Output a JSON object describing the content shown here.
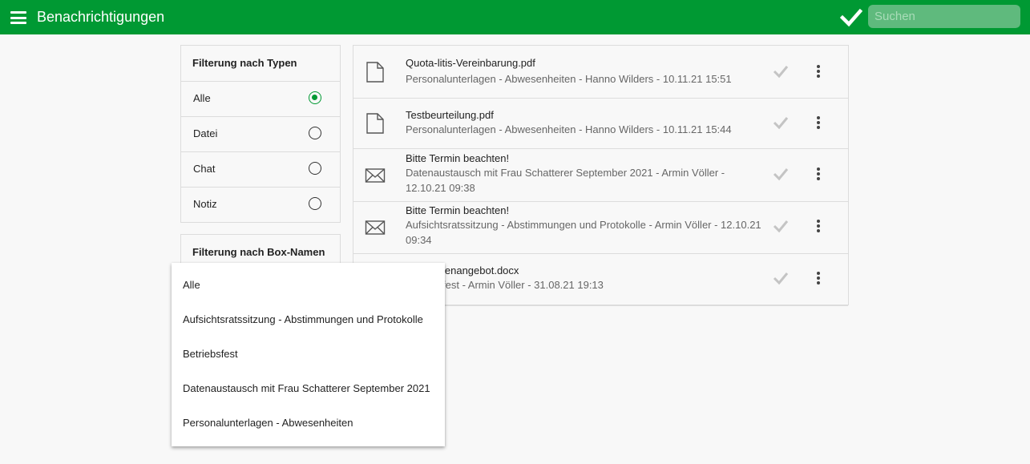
{
  "header": {
    "title": "Benachrichtigungen",
    "menu_icon": "hamburger-menu-icon",
    "check_icon": "checkmark-icon",
    "search_placeholder": "Suchen",
    "search_value": "",
    "colors": {
      "bar": "#009933",
      "search_bg": "#5fba7d"
    }
  },
  "type_filter": {
    "title": "Filterung nach Typen",
    "options": [
      {
        "label": "Alle",
        "selected": true
      },
      {
        "label": "Datei",
        "selected": false
      },
      {
        "label": "Chat",
        "selected": false
      },
      {
        "label": "Notiz",
        "selected": false
      }
    ]
  },
  "box_filter": {
    "title": "Filterung nach Box-Namen",
    "dropdown_options": [
      "Alle",
      "Aufsichtsratssitzung - Abstimmungen und Protokolle",
      "Betriebsfest",
      "Datenaustausch mit Frau Schatterer September 2021",
      "Personalunterlagen - Abwesenheiten"
    ]
  },
  "notifications": [
    {
      "icon": "document-icon",
      "title": "Quota-litis-Vereinbarung.pdf",
      "subtitle": "Personalunterlagen - Abwesenheiten - Hanno Wilders - 10.11.21 15:51"
    },
    {
      "icon": "document-icon",
      "title": "Testbeurteilung.pdf",
      "subtitle": "Personalunterlagen - Abwesenheiten - Hanno Wilders - 10.11.21 15:44"
    },
    {
      "icon": "envelope-icon",
      "title": "Bitte Termin beachten!",
      "subtitle": "Datenaustausch mit Frau Schatterer September 2021 - Armin Völler - 12.10.21 09:38"
    },
    {
      "icon": "envelope-icon",
      "title": "Bitte Termin beachten!",
      "subtitle": "Aufsichtsratssitzung - Abstimmungen und Protokolle - Armin Völler - 12.10.21 09:34"
    },
    {
      "icon": "document-icon",
      "title": "ienangebot.docx",
      "subtitle": "fest - Armin Völler - 31.08.21 19:13"
    }
  ]
}
